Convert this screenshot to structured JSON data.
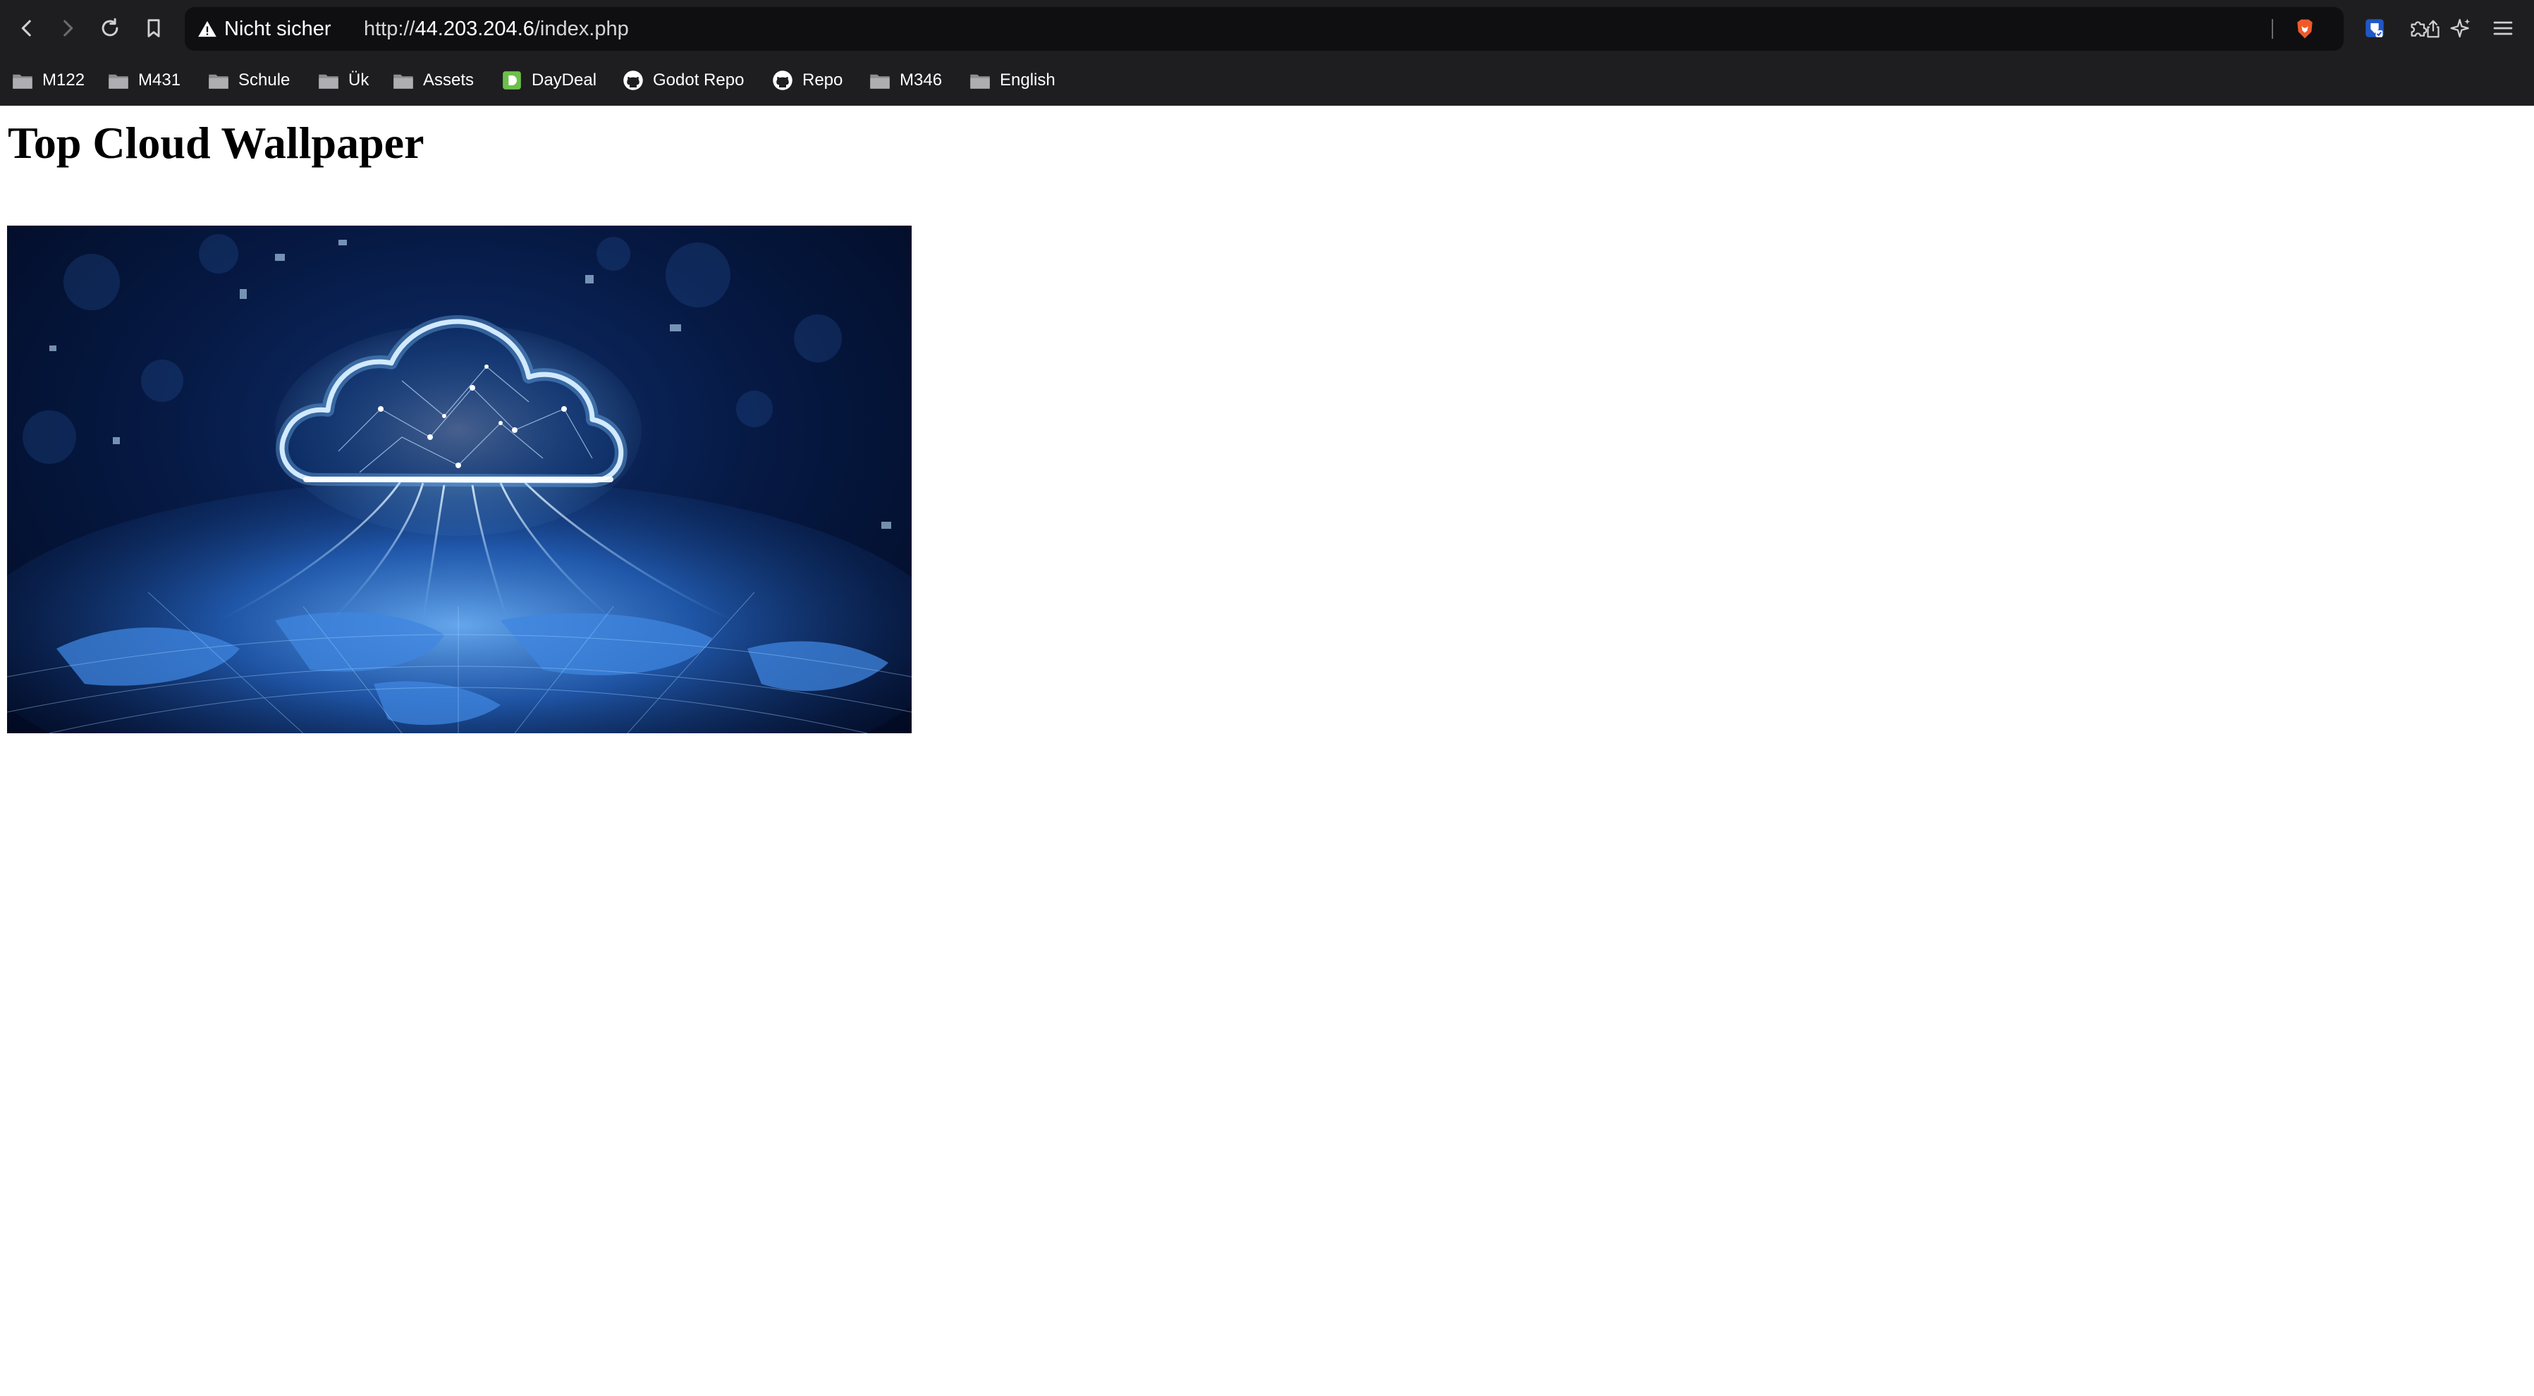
{
  "browser": {
    "security_label": "Nicht sicher",
    "url_prefix": "http://",
    "url_host": "44.203.204.6",
    "url_path": "/index.php",
    "icons": {
      "back": "chevron-left-icon",
      "forward": "chevron-right-icon",
      "reload": "reload-icon",
      "bookmark": "bookmark-icon",
      "warning": "warning-triangle-icon",
      "share": "share-icon",
      "brave_shield": "brave-lion-icon",
      "extension_wallet": "bitwarden-shield-icon",
      "extensions": "puzzle-icon",
      "leo": "sparkle-icon",
      "menu": "hamburger-menu-icon"
    },
    "colors": {
      "chrome_bg": "#1e1e20",
      "urlbar_bg": "#0f0f11",
      "brave_orange": "#f05a2a",
      "shield_blue": "#1f57c7"
    }
  },
  "bookmarks": [
    {
      "label": "M122",
      "icon": "folder-icon"
    },
    {
      "label": "M431",
      "icon": "folder-icon"
    },
    {
      "label": "Schule",
      "icon": "folder-icon"
    },
    {
      "label": "Ük",
      "icon": "folder-icon"
    },
    {
      "label": "Assets",
      "icon": "folder-icon"
    },
    {
      "label": "DayDeal",
      "icon": "daydeal-icon"
    },
    {
      "label": "Godot Repo",
      "icon": "github-icon"
    },
    {
      "label": "Repo",
      "icon": "github-icon"
    },
    {
      "label": "M346",
      "icon": "folder-icon"
    },
    {
      "label": "English",
      "icon": "folder-icon"
    }
  ],
  "page": {
    "title": "Top Cloud Wallpaper",
    "image": {
      "subject": "glowing-cloud-over-digital-world-map",
      "accent": "#4aa8ff"
    }
  }
}
